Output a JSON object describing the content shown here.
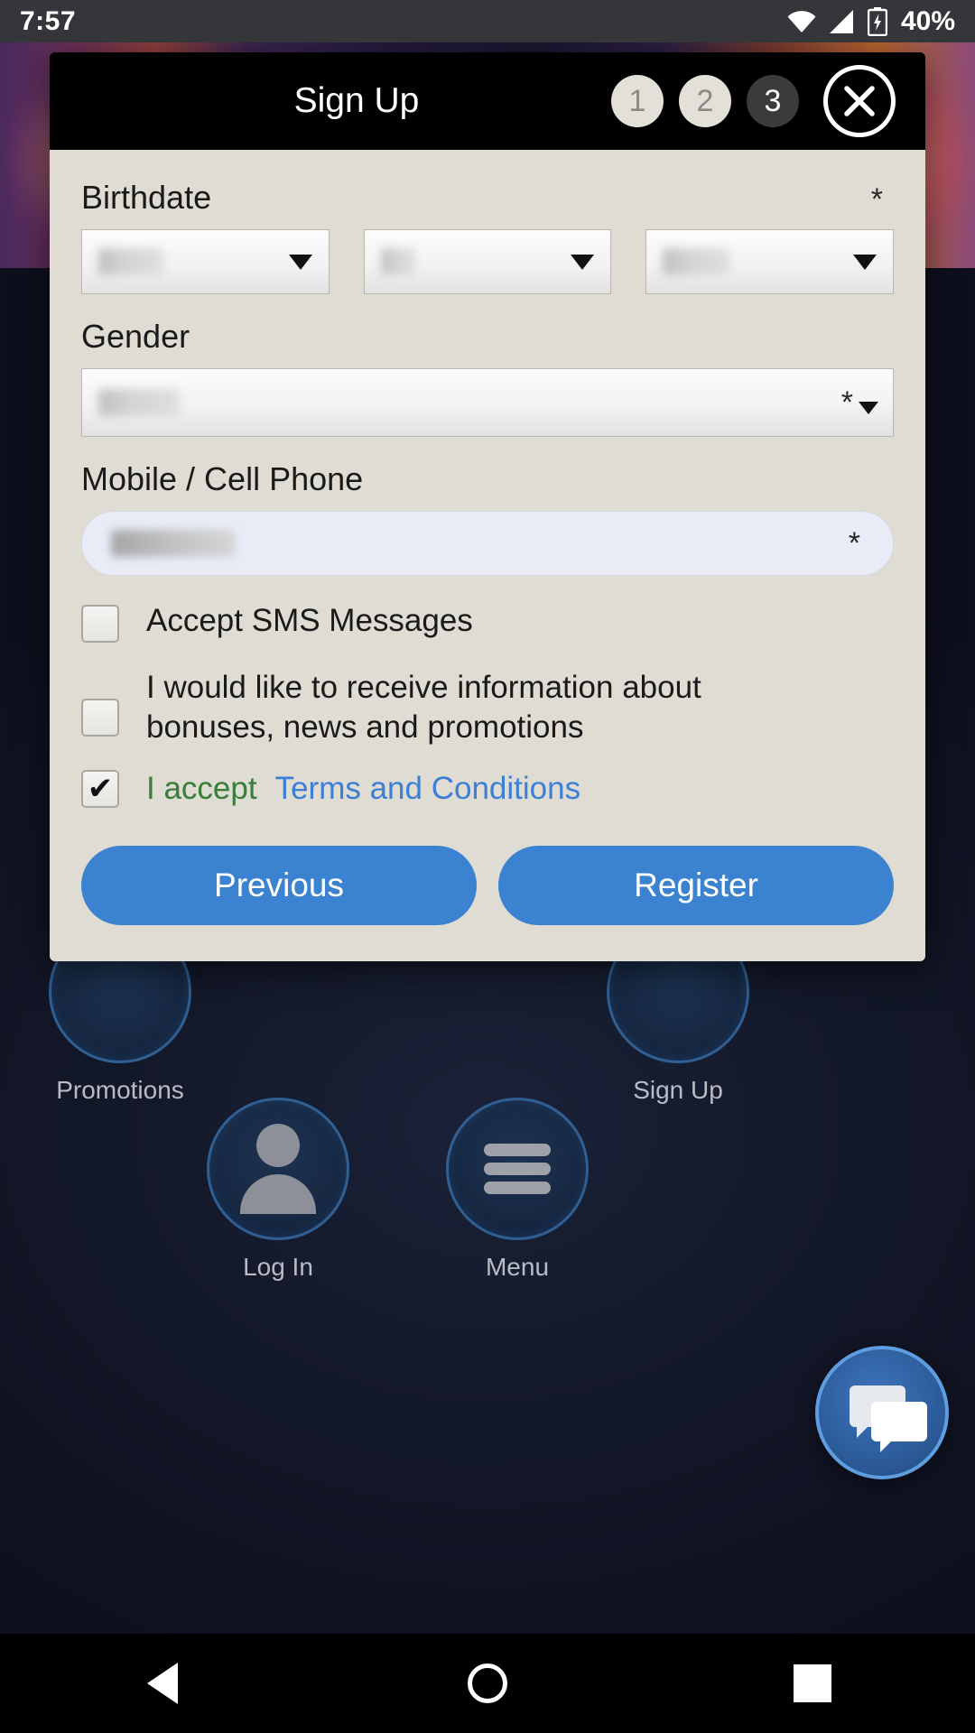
{
  "status_bar": {
    "time": "7:57",
    "battery_percent": "40%",
    "icons": [
      "wifi-icon",
      "cell-signal-icon",
      "battery-charging-icon"
    ]
  },
  "modal": {
    "title": "Sign Up",
    "steps": [
      {
        "label": "1",
        "state": "done"
      },
      {
        "label": "2",
        "state": "done"
      },
      {
        "label": "3",
        "state": "active"
      }
    ],
    "close_icon": "close-icon",
    "fields": {
      "birthdate": {
        "label": "Birthdate",
        "required_marker": "*",
        "selects": [
          {
            "name": "day",
            "value": "",
            "redacted": true,
            "icon": "chevron-down-icon"
          },
          {
            "name": "month",
            "value": "",
            "redacted": true,
            "icon": "chevron-down-icon"
          },
          {
            "name": "year",
            "value": "",
            "redacted": true,
            "icon": "chevron-down-icon"
          }
        ]
      },
      "gender": {
        "label": "Gender",
        "required_marker": "*",
        "value": "",
        "redacted": true,
        "icon": "chevron-down-icon"
      },
      "phone": {
        "label": "Mobile / Cell Phone",
        "required_marker": "*",
        "value": "",
        "redacted": true
      }
    },
    "checkboxes": [
      {
        "label": "Accept SMS Messages",
        "checked": false
      },
      {
        "label": "I would like to receive information about bonuses, news and promotions",
        "checked": false
      }
    ],
    "terms": {
      "checked": true,
      "check_glyph": "✔",
      "accept_text": "I accept",
      "link_text": "Terms and Conditions",
      "accept_color": "#3a7d3a",
      "link_color": "#3c7fd4"
    },
    "buttons": {
      "previous": "Previous",
      "register": "Register",
      "color": "#3b83d0"
    }
  },
  "background_nav": [
    {
      "label": "Promotions",
      "icon": "promotions-icon"
    },
    {
      "label": "Sign Up",
      "icon": "signup-icon"
    },
    {
      "label": "Log In",
      "icon": "person-icon"
    },
    {
      "label": "Menu",
      "icon": "hamburger-icon"
    }
  ],
  "chat_fab": {
    "icon": "chat-bubbles-icon"
  },
  "android_nav": {
    "back": "back-triangle-icon",
    "home": "home-circle-icon",
    "recents": "recents-square-icon"
  }
}
